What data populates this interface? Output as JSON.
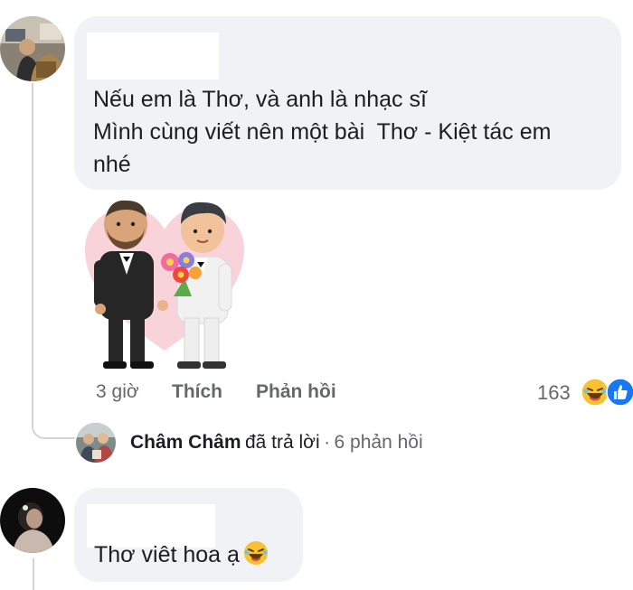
{
  "comment1": {
    "text": "Nếu em là Thơ, và anh là nhạc sĩ\nMình cùng viết nên một bài  Thơ - Kiệt tác em\nnhé",
    "sticker": "wedding-couple-sticker",
    "actions": {
      "time": "3 giờ",
      "like": "Thích",
      "reply": "Phản hồi"
    },
    "reactions": {
      "count": "163",
      "icons": [
        "laugh-reaction-icon",
        "like-reaction-icon"
      ]
    }
  },
  "reply_preview": {
    "name": "Châm Châm",
    "verb": "đã trả lời",
    "separator": "·",
    "count_text": "6 phản hồi"
  },
  "comment2": {
    "text": "Thơ viêt hoa ạ",
    "emoji": "laugh-emoji-icon"
  },
  "colors": {
    "bubble": "#f0f2f5",
    "secondary_text": "#65676b",
    "like_blue": "#1877f2",
    "laugh_yellow": "#f7c12f"
  }
}
